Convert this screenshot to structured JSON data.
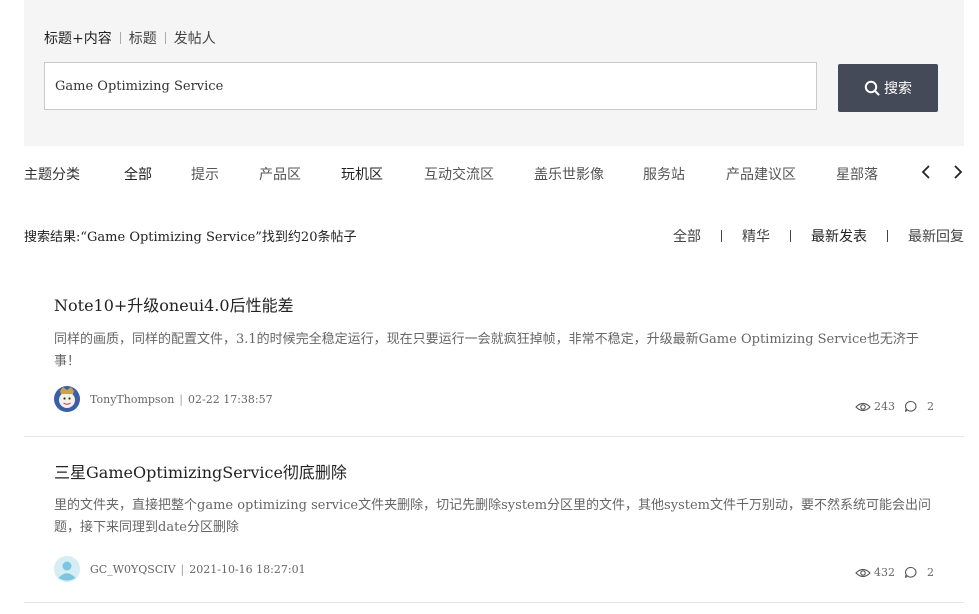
{
  "search": {
    "modes": [
      "标题+内容",
      "标题",
      "发帖人"
    ],
    "query": "Game Optimizing Service",
    "button_label": "搜索"
  },
  "categories": {
    "label": "主题分类",
    "items": [
      "全部",
      "提示",
      "产品区",
      "玩机区",
      "互动交流区",
      "盖乐世影像",
      "服务站",
      "产品建议区",
      "星部落"
    ]
  },
  "results": {
    "summary": "搜索结果:“Game Optimizing Service”找到约20条帖子",
    "sort_tabs": [
      "全部",
      "精华",
      "最新发表",
      "最新回复"
    ]
  },
  "posts": [
    {
      "title": "Note10+升级oneui4.0后性能差",
      "excerpt": "同样的画质，同样的配置文件，3.1的时候完全稳定运行，现在只要运行一会就疯狂掉帧，非常不稳定，升级最新Game Optimizing Service也无济于事！",
      "author": "TonyThompson",
      "time": "02-22 17:38:57",
      "views": "243",
      "replies": "2"
    },
    {
      "title": "三星GameOptimizingService彻底删除",
      "excerpt": "里的文件夹，直接把整个game optimizing service文件夹删除，切记先删除system分区里的文件，其他system文件千万别动，要不然系统可能会出问题，接下来同理到date分区删除",
      "author": "GC_W0YQSCIV",
      "time": "2021-10-16 18:27:01",
      "views": "432",
      "replies": "2"
    }
  ]
}
